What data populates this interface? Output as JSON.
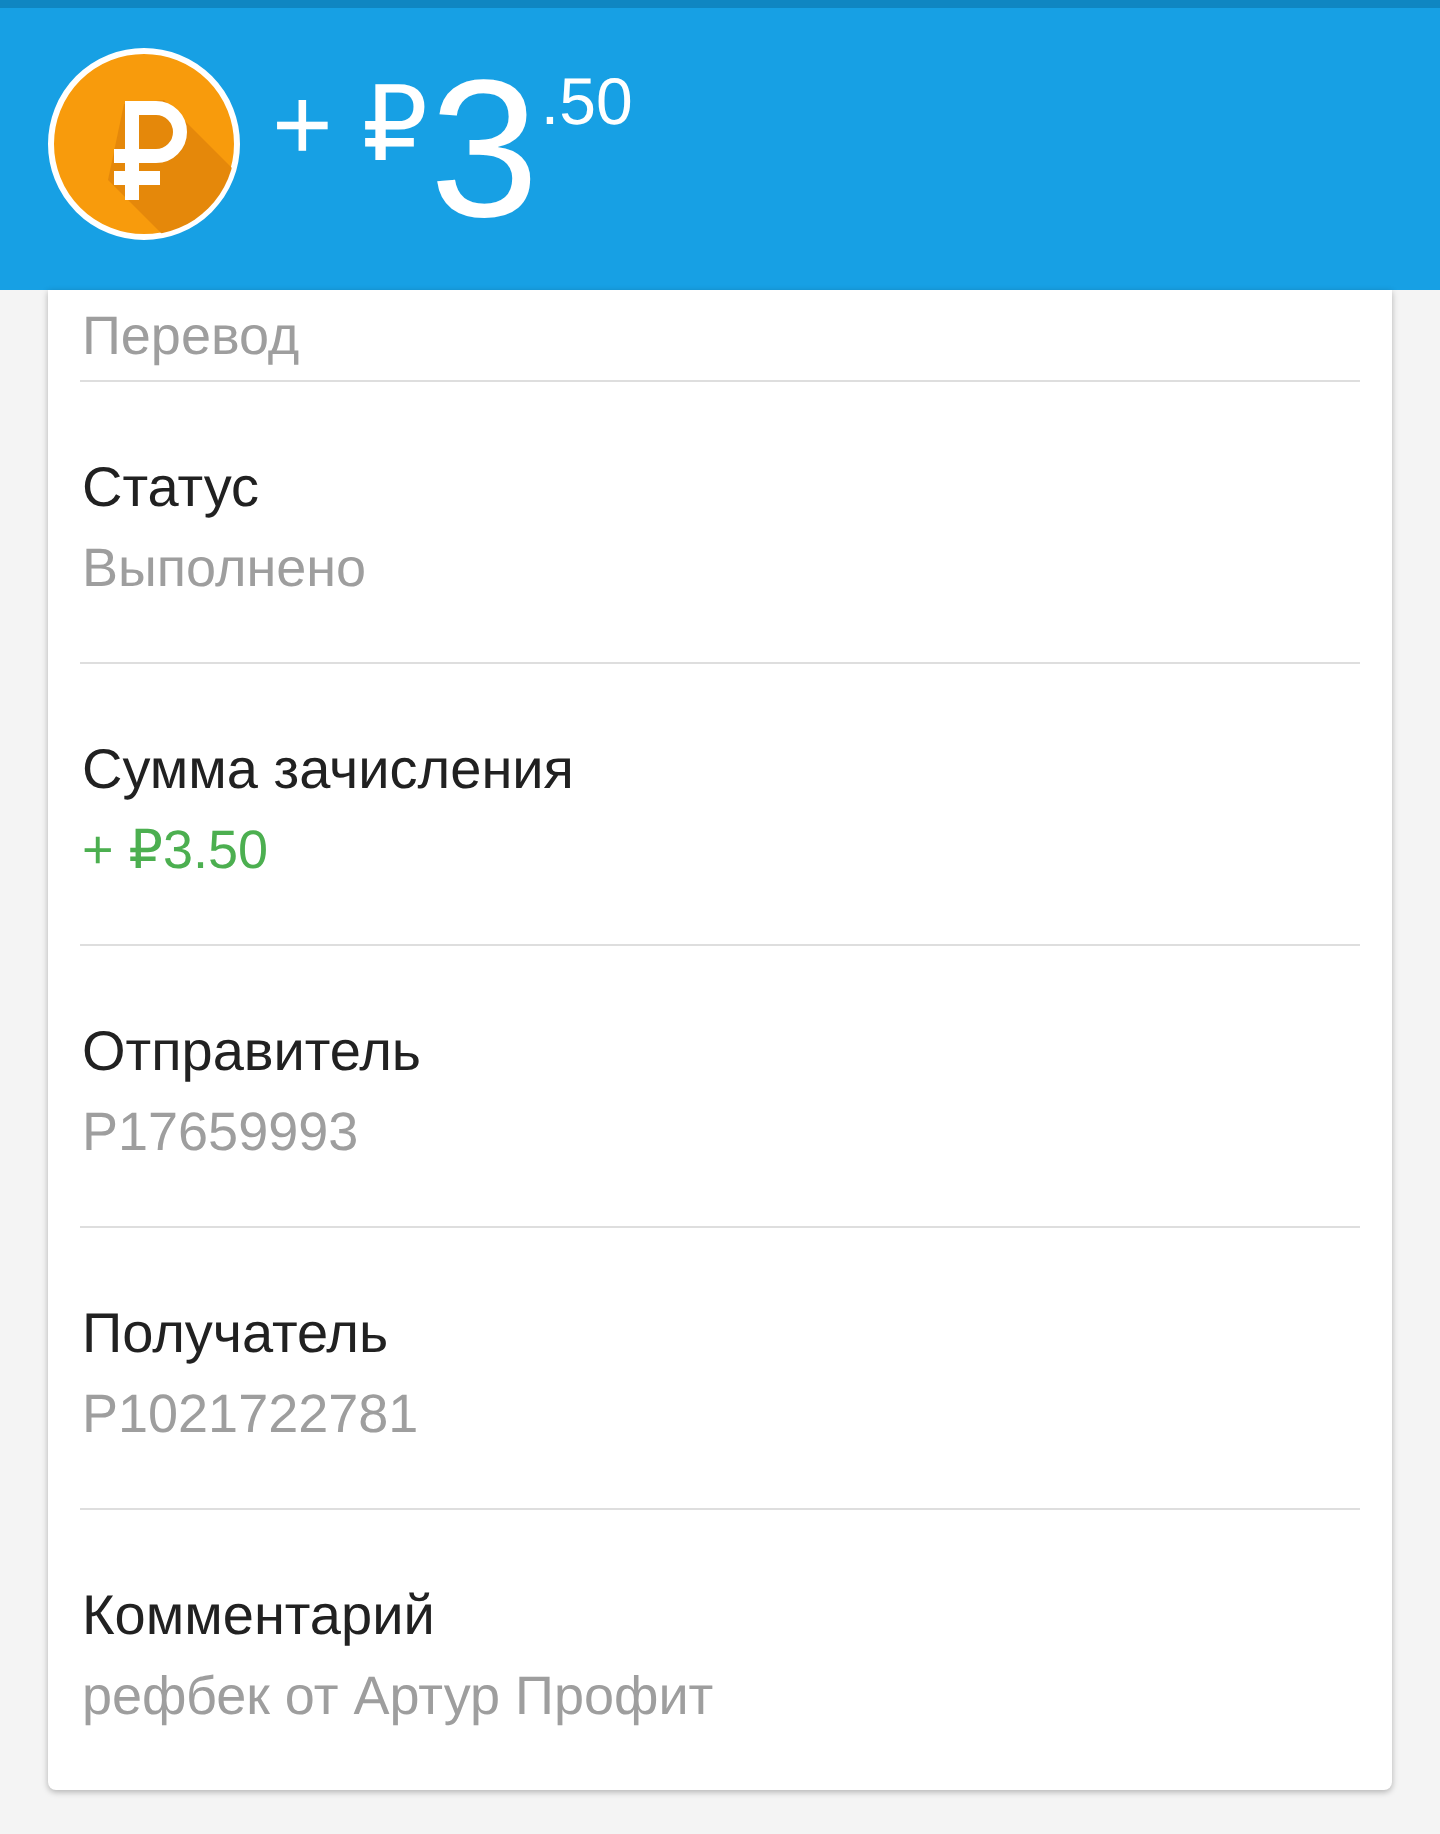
{
  "header": {
    "prefix": "+ ₽",
    "whole": "3",
    "fraction": ".50"
  },
  "details": [
    {
      "kind": "plain",
      "value": "Перевод"
    },
    {
      "kind": "plain",
      "label": "Статус",
      "value": "Выполнено"
    },
    {
      "kind": "credit",
      "label": "Сумма зачисления",
      "value": "+ ₽3.50"
    },
    {
      "kind": "plain",
      "label": "Отправитель",
      "value": "P17659993"
    },
    {
      "kind": "plain",
      "label": "Получатель",
      "value": "P1021722781"
    },
    {
      "kind": "plain",
      "label": "Комментарий",
      "value": "рефбек от Артур Профит"
    }
  ]
}
